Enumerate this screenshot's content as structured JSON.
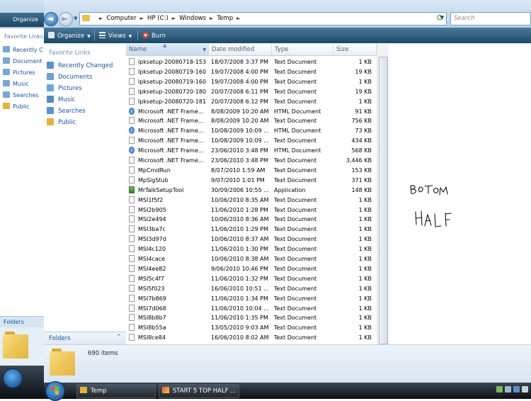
{
  "background_window": {
    "toolbar_label": "Organize",
    "favorite_links_title": "Favorite Links",
    "links": [
      "Recently C",
      "Document",
      "Pictures",
      "Music",
      "Searches",
      "Public"
    ],
    "folders_label": "Folders"
  },
  "address_bar": {
    "crumbs": [
      "Computer",
      "HP (C:)",
      "Windows",
      "Temp"
    ],
    "search_placeholder": "Search"
  },
  "toolbar": {
    "organize": "Organize",
    "views": "Views",
    "burn": "Burn"
  },
  "nav_pane": {
    "title": "Favorite Links",
    "links": [
      {
        "label": "Recently Changed",
        "icon": "recent-icon",
        "color": "#5b8fd0"
      },
      {
        "label": "Documents",
        "icon": "documents-icon",
        "color": "#6d9fcf"
      },
      {
        "label": "Pictures",
        "icon": "pictures-icon",
        "color": "#6aa8d8"
      },
      {
        "label": "Music",
        "icon": "music-icon",
        "color": "#4f8bc6"
      },
      {
        "label": "Searches",
        "icon": "searches-icon",
        "color": "#5a94cc"
      },
      {
        "label": "Public",
        "icon": "public-folder-icon",
        "color": "#e3b23c"
      }
    ],
    "folders_label": "Folders"
  },
  "columns": {
    "name": "Name",
    "date_modified": "Date modified",
    "type": "Type",
    "size": "Size"
  },
  "files": [
    {
      "name": "lpksetup-20080718-153...",
      "date": "18/07/2008 3:37 PM",
      "type": "Text Document",
      "size": "1 KB",
      "icon": "text"
    },
    {
      "name": "lpksetup-20080719-160...",
      "date": "19/07/2008 4:00 PM",
      "type": "Text Document",
      "size": "19 KB",
      "icon": "text"
    },
    {
      "name": "lpksetup-20080719-160...",
      "date": "19/07/2008 4:00 PM",
      "type": "Text Document",
      "size": "1 KB",
      "icon": "text"
    },
    {
      "name": "lpksetup-20080720-180...",
      "date": "20/07/2008 6:11 PM",
      "type": "Text Document",
      "size": "19 KB",
      "icon": "text"
    },
    {
      "name": "lpksetup-20080720-181...",
      "date": "20/07/2008 6:12 PM",
      "type": "Text Document",
      "size": "1 KB",
      "icon": "text"
    },
    {
      "name": "Microsoft .NET Frame...",
      "date": "8/08/2009 10:20 AM",
      "type": "HTML Document",
      "size": "91 KB",
      "icon": "html"
    },
    {
      "name": "Microsoft .NET Frame...",
      "date": "8/08/2009 10:20 AM",
      "type": "Text Document",
      "size": "756 KB",
      "icon": "text"
    },
    {
      "name": "Microsoft .NET Frame...",
      "date": "10/08/2009 10:09 ...",
      "type": "HTML Document",
      "size": "73 KB",
      "icon": "html"
    },
    {
      "name": "Microsoft .NET Frame...",
      "date": "10/08/2009 10:09 ...",
      "type": "Text Document",
      "size": "434 KB",
      "icon": "text"
    },
    {
      "name": "Microsoft .NET Frame...",
      "date": "23/06/2010 3:48 PM",
      "type": "HTML Document",
      "size": "568 KB",
      "icon": "html"
    },
    {
      "name": "Microsoft .NET Frame...",
      "date": "23/06/2010 3:48 PM",
      "type": "Text Document",
      "size": "3,446 KB",
      "icon": "text"
    },
    {
      "name": "MpCmdRun",
      "date": "8/07/2010 1:59 AM",
      "type": "Text Document",
      "size": "153 KB",
      "icon": "text"
    },
    {
      "name": "MpSigStub",
      "date": "9/07/2010 1:01 PM",
      "type": "Text Document",
      "size": "371 KB",
      "icon": "text"
    },
    {
      "name": "MrTalkSetupTool",
      "date": "30/09/2006 10:55 ...",
      "type": "Application",
      "size": "148 KB",
      "icon": "app"
    },
    {
      "name": "MSI1f5f2",
      "date": "10/06/2010 8:35 AM",
      "type": "Text Document",
      "size": "1 KB",
      "icon": "text"
    },
    {
      "name": "MSI2b905",
      "date": "11/06/2010 1:28 PM",
      "type": "Text Document",
      "size": "1 KB",
      "icon": "text"
    },
    {
      "name": "MSI2e494",
      "date": "10/06/2010 8:36 AM",
      "type": "Text Document",
      "size": "1 KB",
      "icon": "text"
    },
    {
      "name": "MSI3ba7c",
      "date": "11/06/2010 1:29 PM",
      "type": "Text Document",
      "size": "1 KB",
      "icon": "text"
    },
    {
      "name": "MSI3d97d",
      "date": "10/06/2010 8:37 AM",
      "type": "Text Document",
      "size": "1 KB",
      "icon": "text"
    },
    {
      "name": "MSI4c120",
      "date": "11/06/2010 1:30 PM",
      "type": "Text Document",
      "size": "1 KB",
      "icon": "text"
    },
    {
      "name": "MSI4cace",
      "date": "10/06/2010 8:38 AM",
      "type": "Text Document",
      "size": "1 KB",
      "icon": "text"
    },
    {
      "name": "MSI4ee82",
      "date": "9/06/2010 10:46 PM",
      "type": "Text Document",
      "size": "1 KB",
      "icon": "text"
    },
    {
      "name": "MSI5c4f7",
      "date": "11/06/2010 1:32 PM",
      "type": "Text Document",
      "size": "1 KB",
      "icon": "text"
    },
    {
      "name": "MSI5f023",
      "date": "16/06/2010 10:51 ...",
      "type": "Text Document",
      "size": "1 KB",
      "icon": "text"
    },
    {
      "name": "MSI7b869",
      "date": "11/06/2010 1:34 PM",
      "type": "Text Document",
      "size": "1 KB",
      "icon": "text"
    },
    {
      "name": "MSI7d068",
      "date": "11/06/2010 10:04 ...",
      "type": "Text Document",
      "size": "1 KB",
      "icon": "text"
    },
    {
      "name": "MSI8b8b7",
      "date": "11/06/2010 1:35 PM",
      "type": "Text Document",
      "size": "1 KB",
      "icon": "text"
    },
    {
      "name": "MSI8b55a",
      "date": "13/05/2010 9:03 AM",
      "type": "Text Document",
      "size": "1 KB",
      "icon": "text"
    },
    {
      "name": "MSI8ce84",
      "date": "16/06/2010 8:02 AM",
      "type": "Text Document",
      "size": "1 KB",
      "icon": "text"
    }
  ],
  "annotation": {
    "lines": [
      "BOTTOM",
      "HALF"
    ],
    "color": "#111111"
  },
  "details": {
    "item_count": "690 items"
  },
  "taskbar": {
    "tasks": [
      {
        "label": "Temp",
        "icon": "folder-icon"
      },
      {
        "label": "START 5 TOP HALF ...",
        "icon": "paint-icon"
      }
    ]
  },
  "colors": {
    "toolbar": "#1c4866",
    "link": "#1a4fa0",
    "taskbar": "#0b0f14"
  }
}
